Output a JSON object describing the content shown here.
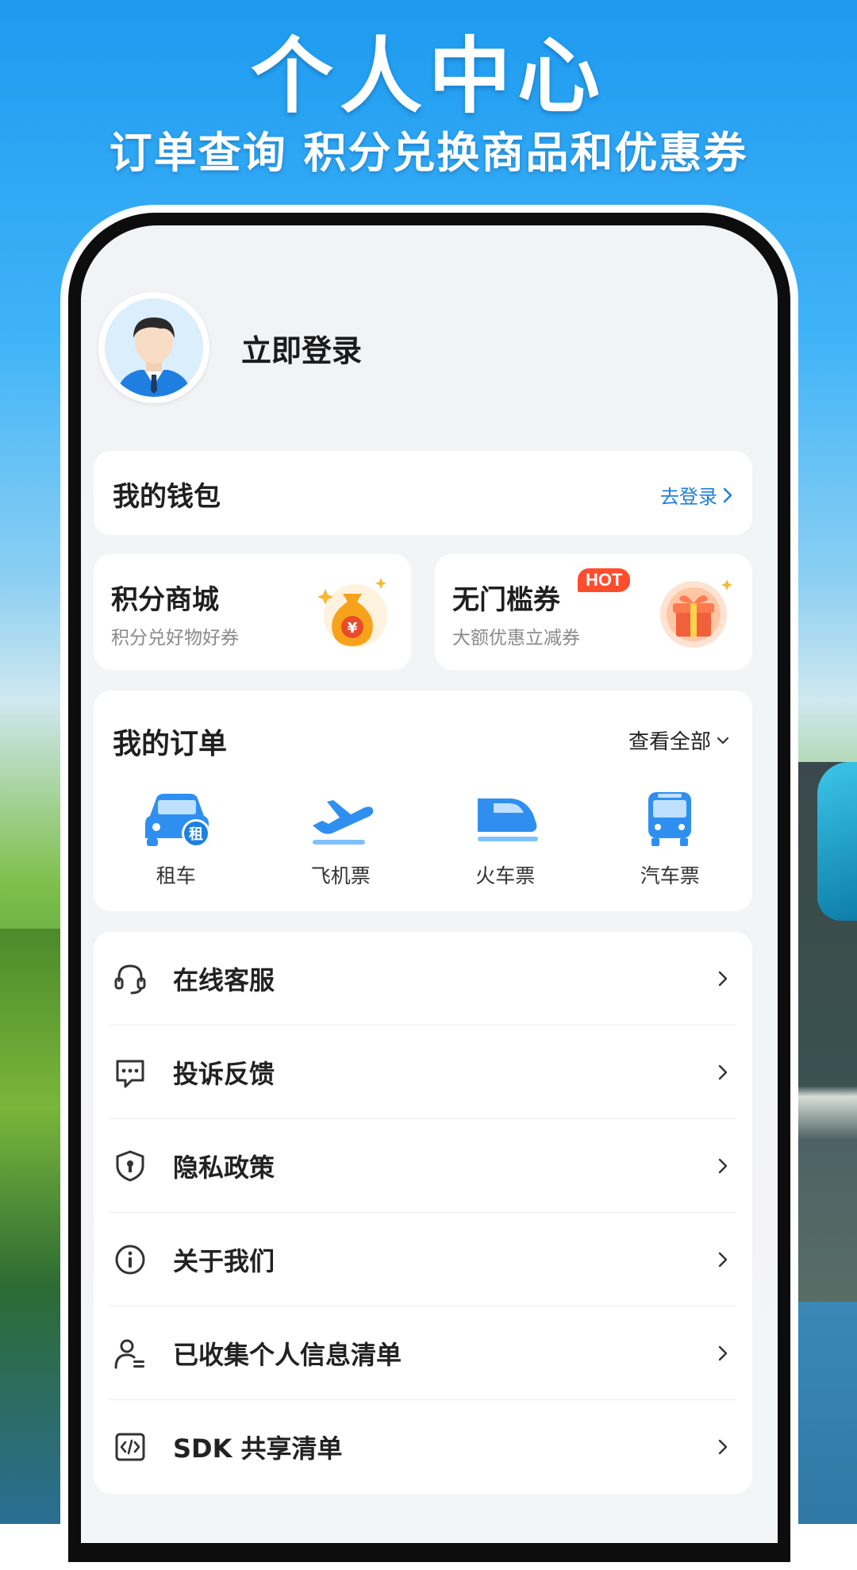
{
  "headline": {
    "title": "个人中心",
    "subtitle": "订单查询 积分兑换商品和优惠券"
  },
  "profile": {
    "avatar_icon": "user-avatar-icon",
    "login_label": "立即登录"
  },
  "wallet": {
    "title": "我的钱包",
    "action_label": "去登录"
  },
  "promos": [
    {
      "title": "积分商城",
      "subtitle": "积分兑好物好券",
      "icon": "money-bag-icon"
    },
    {
      "title": "无门槛券",
      "subtitle": "大额优惠立减券",
      "icon": "gift-box-icon",
      "badge": "HOT"
    }
  ],
  "orders": {
    "title": "我的订单",
    "view_all_label": "查看全部",
    "items": [
      {
        "label": "租车",
        "icon": "car-rental-icon"
      },
      {
        "label": "飞机票",
        "icon": "airplane-icon"
      },
      {
        "label": "火车票",
        "icon": "train-icon"
      },
      {
        "label": "汽车票",
        "icon": "bus-icon"
      }
    ]
  },
  "menu": [
    {
      "label": "在线客服",
      "icon": "headset-icon"
    },
    {
      "label": "投诉反馈",
      "icon": "chat-bubble-icon"
    },
    {
      "label": "隐私政策",
      "icon": "shield-lock-icon"
    },
    {
      "label": "关于我们",
      "icon": "info-icon"
    },
    {
      "label": "已收集个人信息清单",
      "icon": "user-list-icon"
    },
    {
      "label": "SDK 共享清单",
      "icon": "code-icon"
    }
  ],
  "colors": {
    "accent_blue": "#1d7fe0",
    "icon_blue": "#2f8ff0",
    "hot_red": "#ff4d2e",
    "bag_orange": "#f7a21b"
  }
}
